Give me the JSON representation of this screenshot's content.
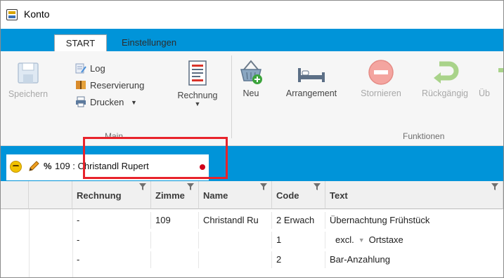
{
  "window": {
    "title": "Konto"
  },
  "tabs": [
    {
      "label": "START",
      "active": true
    },
    {
      "label": "Einstellungen",
      "active": false
    }
  ],
  "ribbon": {
    "main_group": {
      "label": "Main",
      "save_label": "Speichern",
      "log_label": "Log",
      "reservation_label": "Reservierung",
      "print_label": "Drucken",
      "invoice_label": "Rechnung"
    },
    "functions_group": {
      "label": "Funktionen",
      "new_label": "Neu",
      "arrangement_label": "Arrangement",
      "cancel_label": "Stornieren",
      "undo_label": "Rückgängig",
      "cut_label": "Üb"
    }
  },
  "document_tab": {
    "percent": "%",
    "label": "109 : Christandl Rupert"
  },
  "grid": {
    "columns": [
      "",
      "",
      "Rechnung",
      "Zimme",
      "Name",
      "Code",
      "Text"
    ],
    "rows": [
      {
        "rechnung": "-",
        "zimmer": "109",
        "name": "Christandl Ru",
        "code": "2 Erwach",
        "text": "Übernachtung Frühstück"
      },
      {
        "rechnung": "-",
        "zimmer": "",
        "name": "",
        "code": "1",
        "text_prefix": "excl.",
        "text": "Ortstaxe"
      },
      {
        "rechnung": "-",
        "zimmer": "",
        "name": "",
        "code": "2",
        "text": "Bar-Anzahlung"
      }
    ]
  },
  "colors": {
    "accent": "#0094d9",
    "highlight": "#e8232b",
    "status_dot": "#d0021b"
  }
}
